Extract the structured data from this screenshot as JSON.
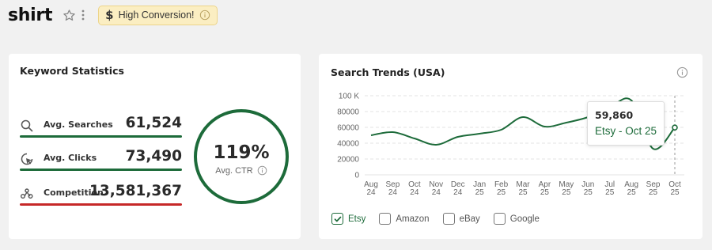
{
  "header": {
    "title": "shirt",
    "badge_label": "High Conversion!"
  },
  "keyword_stats": {
    "title": "Keyword Statistics",
    "stats": [
      {
        "label": "Avg. Searches",
        "value": "61,524",
        "icon": "search-icon",
        "bar_color": "#1d6b3a"
      },
      {
        "label": "Avg. Clicks",
        "value": "73,490",
        "icon": "click-icon",
        "bar_color": "#1d6b3a"
      },
      {
        "label": "Competition",
        "value": "13,581,367",
        "icon": "competition-icon",
        "bar_color": "#c62828"
      }
    ],
    "ctr_value": "119%",
    "ctr_label": "Avg. CTR"
  },
  "search_trends": {
    "title": "Search Trends (USA)",
    "tooltip": {
      "value": "59,860",
      "label": "Etsy - Oct 25"
    },
    "legend": [
      {
        "label": "Etsy",
        "checked": true
      },
      {
        "label": "Amazon",
        "checked": false
      },
      {
        "label": "eBay",
        "checked": false
      },
      {
        "label": "Google",
        "checked": false
      }
    ]
  },
  "colors": {
    "accent": "#1d6b3a",
    "danger": "#c62828",
    "badge_bg": "#fbeec2"
  },
  "chart_data": {
    "type": "line",
    "title": "Search Trends (USA)",
    "x_ticks": [
      [
        "Aug",
        "24"
      ],
      [
        "Sep",
        "24"
      ],
      [
        "Oct",
        "24"
      ],
      [
        "Nov",
        "24"
      ],
      [
        "Dec",
        "24"
      ],
      [
        "Jan",
        "25"
      ],
      [
        "Feb",
        "25"
      ],
      [
        "Mar",
        "25"
      ],
      [
        "Apr",
        "25"
      ],
      [
        "May",
        "25"
      ],
      [
        "Jun",
        "25"
      ],
      [
        "Jul",
        "25"
      ],
      [
        "Aug",
        "25"
      ],
      [
        "Sep",
        "25"
      ],
      [
        "Oct",
        "25"
      ]
    ],
    "y_ticks": [
      "100 K",
      "80000",
      "60000",
      "40000",
      "20000",
      "0"
    ],
    "ylim": [
      0,
      100000
    ],
    "grid": true,
    "series": [
      {
        "name": "Etsy",
        "color": "#1d6b3a",
        "values": [
          50000,
          54000,
          46000,
          38000,
          48000,
          52000,
          57000,
          73000,
          61000,
          66000,
          73000,
          85000,
          94000,
          33000,
          59860
        ]
      }
    ]
  }
}
